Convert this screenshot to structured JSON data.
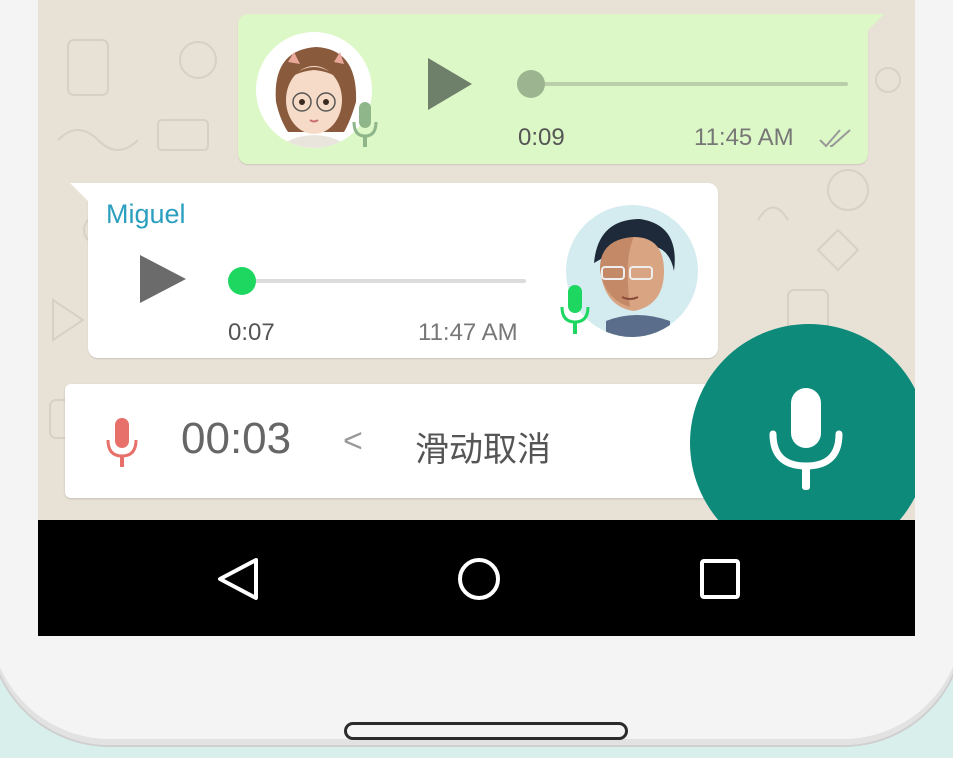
{
  "messages": [
    {
      "direction": "outgoing",
      "duration": "0:09",
      "time": "11:45 AM",
      "status": "read-double-check-icon"
    },
    {
      "direction": "incoming",
      "sender": "Miguel",
      "duration": "0:07",
      "time": "11:47 AM"
    }
  ],
  "recording": {
    "timer": "00:03",
    "chevron": "<",
    "slide_to_cancel": "滑动取消"
  },
  "icons": {
    "play": "play-icon",
    "mic": "mic-icon",
    "back": "back-triangle-icon",
    "home": "home-circle-icon",
    "recents": "recents-square-icon"
  },
  "colors": {
    "outgoing_bubble": "#dcf8c6",
    "incoming_bubble": "#ffffff",
    "accent_green": "#1ed760",
    "sender_name": "#2a9fbf",
    "record_mic": "#e8706a",
    "fab": "#0d8a7a"
  }
}
